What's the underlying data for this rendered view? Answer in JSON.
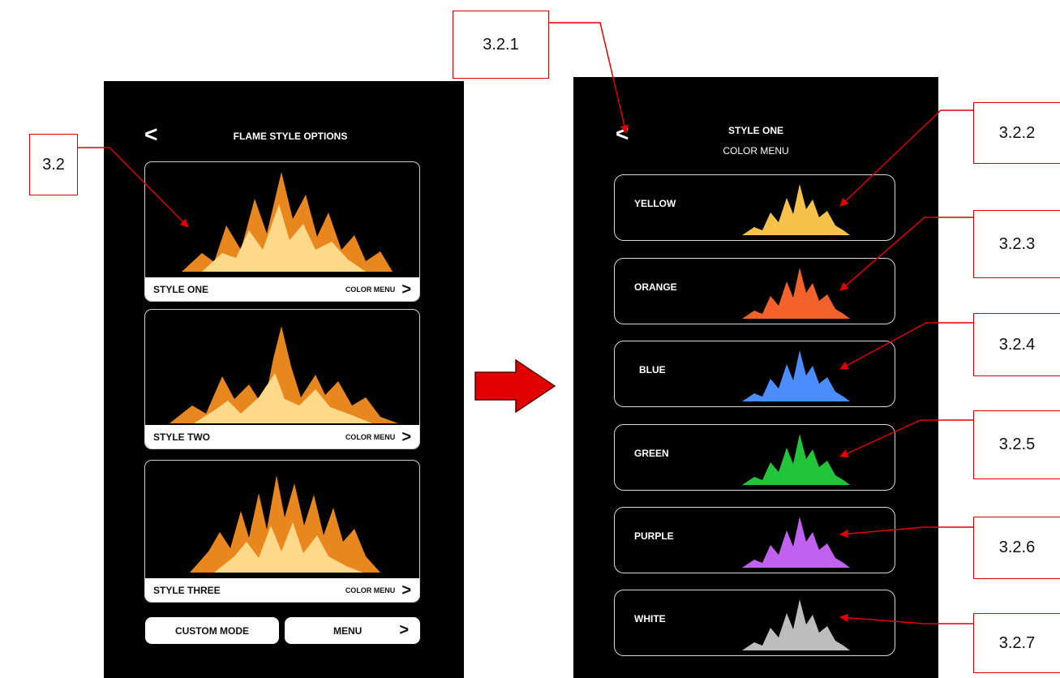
{
  "left_screen": {
    "back_label": "<",
    "title": "FLAME STYLE OPTIONS",
    "styles": [
      {
        "name": "STYLE ONE",
        "color_menu": "COLOR MENU",
        "chevron": ">"
      },
      {
        "name": "STYLE TWO",
        "color_menu": "COLOR MENU",
        "chevron": ">"
      },
      {
        "name": "STYLE THREE",
        "color_menu": "COLOR MENU",
        "chevron": ">"
      }
    ],
    "custom_mode": "CUSTOM MODE",
    "menu": "MENU",
    "menu_chevron": ">"
  },
  "right_screen": {
    "back_label": "<",
    "title": "STYLE ONE",
    "subtitle": "COLOR MENU",
    "colors": [
      {
        "name": "YELLOW",
        "color": "#f6c24a"
      },
      {
        "name": "ORANGE",
        "color": "#f2622a"
      },
      {
        "name": "BLUE",
        "color": "#4b8cff"
      },
      {
        "name": "GREEN",
        "color": "#22c53a"
      },
      {
        "name": "PURPLE",
        "color": "#c061f0"
      },
      {
        "name": "WHITE",
        "color": "#bdbdbd"
      }
    ]
  },
  "callouts": {
    "left": "3.2",
    "back": "3.2.1",
    "colors": [
      "3.2.2",
      "3.2.3",
      "3.2.4",
      "3.2.5",
      "3.2.6",
      "3.2.7"
    ]
  },
  "theme": {
    "annotation_red": "#e00000",
    "flame_outer": "#e8871e",
    "flame_inner": "#ffd98a"
  }
}
